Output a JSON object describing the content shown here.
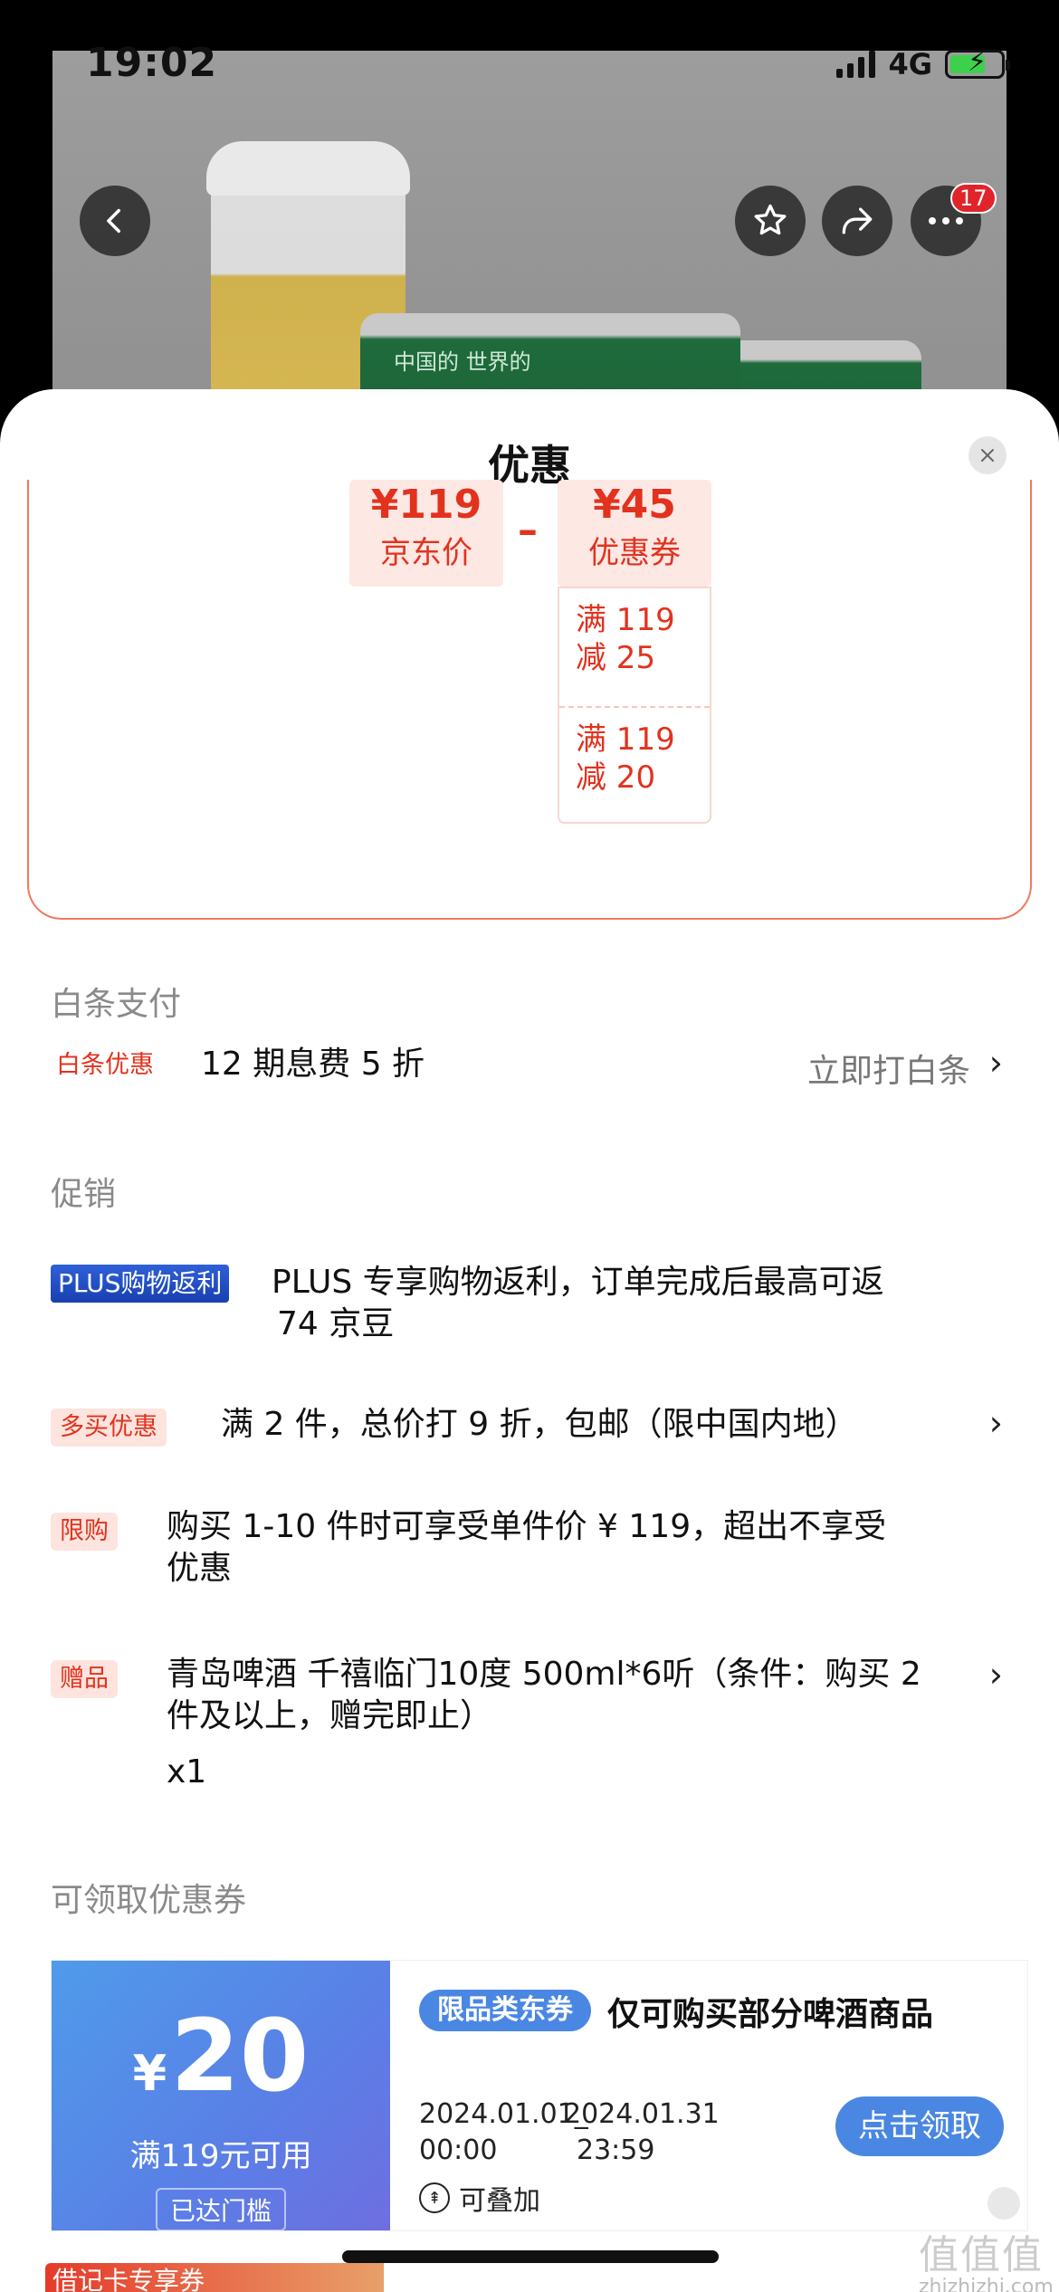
{
  "status_bar": {
    "time": "19:02",
    "network": "4G"
  },
  "product_page": {
    "can_text": "中国的 世界的",
    "notification_count": "17"
  },
  "sheet": {
    "title": "优惠",
    "calculation": {
      "jd_price_value": "¥119",
      "jd_price_label": "京东价",
      "minus": "–",
      "coupon_value": "¥45",
      "coupon_label": "优惠券",
      "coupons": [
        {
          "line1": "满 119",
          "line2": "减 25"
        },
        {
          "line1": "满 119",
          "line2": "减 20"
        }
      ]
    },
    "baitiao": {
      "section_title": "白条支付",
      "tag": "白条优惠",
      "text": "12 期息费 5 折",
      "link": "立即打白条"
    },
    "promotions": {
      "section_title": "促销",
      "items": [
        {
          "tag": "PLUS购物返利",
          "line1": "PLUS 专享购物返利，订单完成后最高可返",
          "line2": "74 京豆"
        },
        {
          "tag": "多买优惠",
          "line1": "满 2 件，总价打 9 折，包邮（限中国内地）"
        },
        {
          "tag": "限购",
          "line1": "购买 1-10 件时可享受单件价 ¥ 119，超出不享受",
          "line2": "优惠"
        },
        {
          "tag": "赠品",
          "line1": "青岛啤酒 千禧临门10度 500ml*6听（条件：购买 2",
          "line2": "件及以上，赠完即止）",
          "line3": "x1"
        }
      ]
    },
    "coupons_section": {
      "section_title": "可领取优惠券",
      "card": {
        "currency": "¥",
        "amount": "20",
        "condition": "满119元可用",
        "status": "已达门槛",
        "type_tag": "限品类东券",
        "description": "仅可购买部分啤酒商品",
        "date_start": "2024.01.01",
        "time_start": "00:00",
        "date_end": "2024.01.31",
        "time_end": "23:59",
        "separator": "_",
        "claim_label": "点击领取",
        "stackable_label": "可叠加"
      },
      "next_card_tag": "借记卡专享券"
    }
  },
  "watermark": {
    "text": "值值值",
    "site": "zhizhizhi.com"
  },
  "colors": {
    "accent_red": "#e2321e",
    "coupon_blue": "#4a87e3",
    "plus_blue": "#1840b0"
  }
}
